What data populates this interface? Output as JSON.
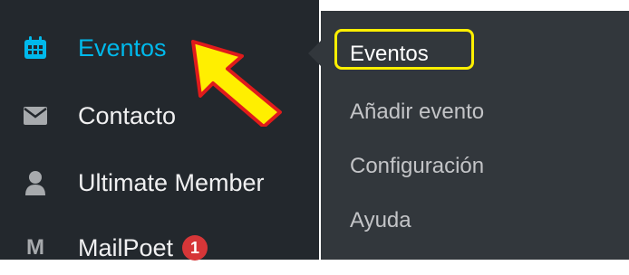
{
  "sidebar": {
    "items": [
      {
        "label": "Eventos",
        "icon": "calendar-icon",
        "active": true
      },
      {
        "label": "Contacto",
        "icon": "envelope-icon",
        "active": false
      },
      {
        "label": "Ultimate Member",
        "icon": "user-icon",
        "active": false
      },
      {
        "label": "MailPoet",
        "icon": "M",
        "badge": "1",
        "active": false
      }
    ]
  },
  "submenu": {
    "items": [
      {
        "label": "Eventos",
        "current": true
      },
      {
        "label": "Añadir evento"
      },
      {
        "label": "Configuración"
      },
      {
        "label": "Ayuda"
      }
    ]
  },
  "colors": {
    "sidebar_bg": "#23282d",
    "submenu_bg": "#32373c",
    "active_text": "#00b9eb",
    "highlight": "#ffef00",
    "badge": "#d63638"
  }
}
